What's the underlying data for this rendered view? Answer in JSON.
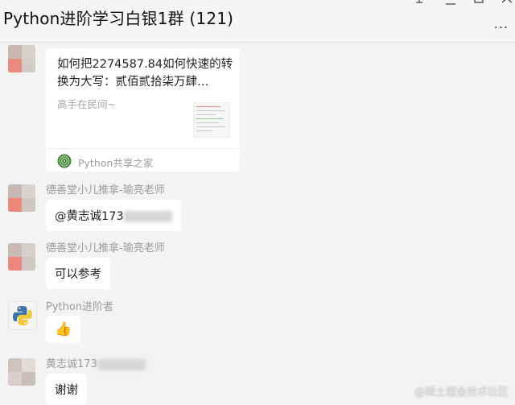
{
  "window": {
    "title": "Python进阶学习白银1群 (121)",
    "more_label": "..."
  },
  "messages": [
    {
      "type": "link-card",
      "card": {
        "title": "如何把2274587.84如何快速的转换为大写：贰佰贰拾柒万肆…",
        "description": "高手在民间~",
        "source": "Python共享之家"
      }
    },
    {
      "type": "text",
      "sender": "德善堂小儿推拿-瑜亮老师",
      "text": "@黄志诚173"
    },
    {
      "type": "text",
      "sender": "德善堂小儿推拿-瑜亮老师",
      "text": "可以参考"
    },
    {
      "type": "emoji",
      "sender": "Python进阶者",
      "emoji": "👍"
    },
    {
      "type": "text",
      "sender": "黄志诚173",
      "text": "谢谢"
    }
  ],
  "watermark": "@稀土掘金技术社区",
  "colors": {
    "background": "#f3f3f3",
    "bubble": "#ffffff",
    "sender_name": "#9a9a9a"
  }
}
